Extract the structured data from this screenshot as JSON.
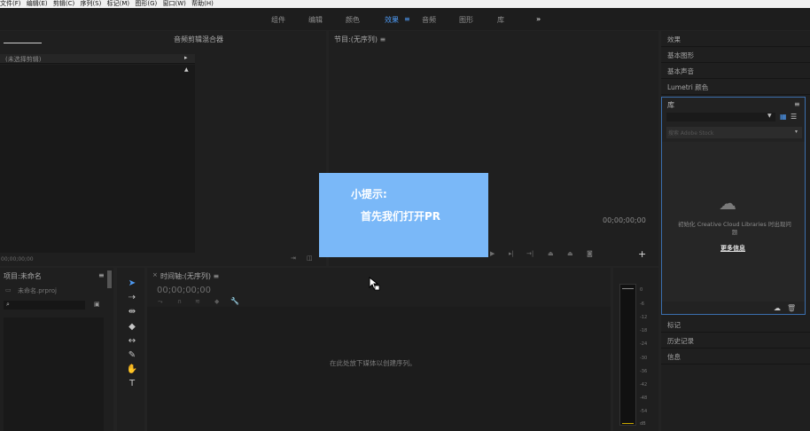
{
  "menu": [
    "文件(F)",
    "编辑(E)",
    "剪辑(C)",
    "序列(S)",
    "标记(M)",
    "图形(G)",
    "窗口(W)",
    "帮助(H)"
  ],
  "workspaces": {
    "assembly": "组件",
    "editing": "编辑",
    "color": "颜色",
    "effects": "效果",
    "effects_menu": "≡",
    "audio": "音频",
    "graphics": "图形",
    "libraries": "库",
    "more": "»"
  },
  "source_panel": {
    "title": "音频剪辑混合器",
    "no_clip": "(未选择剪辑)",
    "timecode": "00;00;00;00"
  },
  "program_panel": {
    "title": "节目:(无序列) ≡",
    "timecode": "00;00;00;00"
  },
  "project_panel": {
    "title": "项目:未命名",
    "menu_icon": "≡",
    "file_name": "未命名.prproj"
  },
  "timeline_panel": {
    "close": "×",
    "title": "时间轴:(无序列) ≡",
    "timecode": "00;00;00;00",
    "empty_msg": "在此处放下媒体以创建序列。"
  },
  "right_panel": {
    "effects": "效果",
    "essential_graphics": "基本图形",
    "essential_sound": "基本声音",
    "lumetri": "Lumetri 颜色",
    "libraries": "库",
    "libraries_menu": "≡",
    "search_placeholder": "搜索 Adobe Stock",
    "init_msg": "初始化 Creative Cloud Libraries 时出现问题",
    "more_info": "更多信息",
    "markers": "标记",
    "history": "历史记录",
    "info": "信息"
  },
  "tip": {
    "title": "小提示:",
    "body": "首先我们打开PR"
  },
  "meter_ticks": [
    "0",
    "-6",
    "-12",
    "-18",
    "-24",
    "-30",
    "-36",
    "-42",
    "-48",
    "-54",
    "dB"
  ]
}
